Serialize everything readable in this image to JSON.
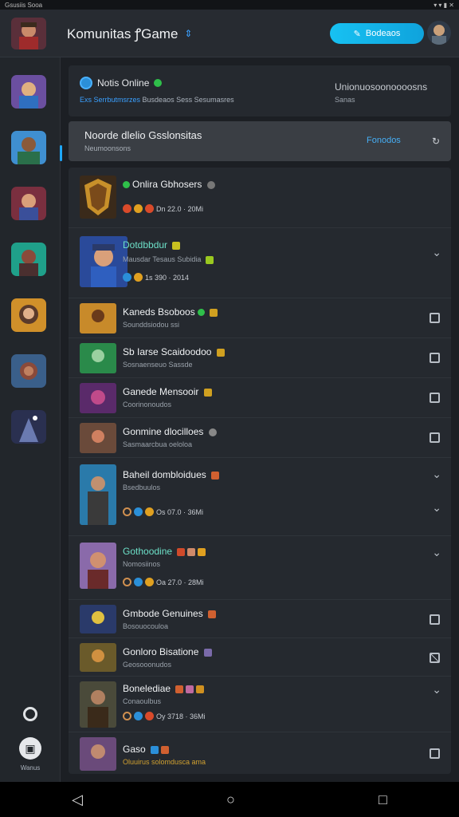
{
  "status_bar": {
    "left": "Gsusiis Sooa",
    "right": "▾ ▾ ▮ ✕"
  },
  "header": {
    "title": "Komunitas ꝭGame",
    "button_label": "Bodeaos",
    "accent": "#17c1f2"
  },
  "notif": {
    "title": "Notis Online",
    "subtitle_highlight": "Exs Serrbutmsrzes",
    "subtitle_rest": "Busdeaos Sess Sesumasres",
    "side_title": "Unionuosoonoooosns",
    "side_sub": "Sanas"
  },
  "section": {
    "title": "Noorde dlelio Gsslonsitas",
    "subtitle": "Neumoonsons",
    "link": "Fonodos"
  },
  "items": [
    {
      "name": "Onlira Gbhosers",
      "meta": "Dn 22.0 · 20Mi",
      "kind": "plain"
    },
    {
      "name": "Dotdbbdur",
      "sub": "Mausdar Tesaus Subidia",
      "meta": "1s 390 · 2014",
      "kind": "chevron"
    },
    {
      "name": "Kaneds Bsoboos",
      "sub": "Sounddsiodou ssi",
      "kind": "checkbox"
    },
    {
      "name": "Sb Iarse Scaidoodoo",
      "sub": "Sosnaenseuo Sassde",
      "kind": "checkbox"
    },
    {
      "name": "Ganede Mensooir",
      "sub": "Coorinonoudos",
      "kind": "checkbox"
    },
    {
      "name": "Gonmine dlocilloes",
      "sub": "Sasmaarcbua oeloloa",
      "kind": "checkbox"
    },
    {
      "name": "Baheil dombloidues",
      "sub": "Bsedbuulos",
      "meta": "Os 07.0 · 36Mi",
      "kind": "chevron2"
    },
    {
      "name": "Gothoodine",
      "sub": "Nomosiinos",
      "meta": "Oa 27.0 · 28Mi",
      "kind": "chevron"
    },
    {
      "name": "Gmbode Genuines",
      "sub": "Bosouocouloa",
      "kind": "checkbox"
    },
    {
      "name": "Gonloro Bisatione",
      "sub": "Geosooonudos",
      "kind": "checkbox-checked"
    },
    {
      "name": "Bonelediae",
      "sub": "Conaoulbus",
      "meta": "Oy 3718 · 36Mi",
      "kind": "chevron"
    },
    {
      "name": "Gaso",
      "sub": "Oluuirus solomdusca ama",
      "kind": "checkbox"
    }
  ],
  "sidebar_bottom_label": "Wanus"
}
